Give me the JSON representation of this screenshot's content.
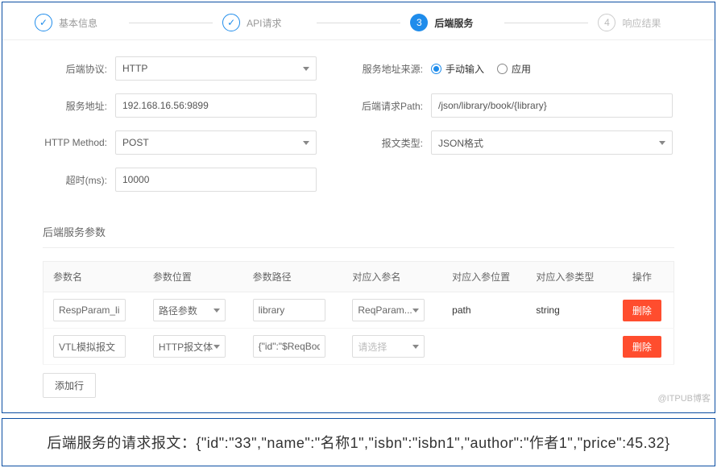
{
  "stepper": {
    "steps": [
      {
        "label": "基本信息",
        "state": "done",
        "icon": "✓"
      },
      {
        "label": "API请求",
        "state": "done",
        "icon": "✓"
      },
      {
        "label": "后端服务",
        "state": "active",
        "icon": "3"
      },
      {
        "label": "响应结果",
        "state": "pending",
        "icon": "4"
      }
    ]
  },
  "form": {
    "protocol_label": "后端协议:",
    "protocol_value": "HTTP",
    "source_label": "服务地址来源:",
    "source_options": {
      "manual": "手动输入",
      "app": "应用"
    },
    "address_label": "服务地址:",
    "address_value": "192.168.16.56:9899",
    "path_label": "后端请求Path:",
    "path_value": "/json/library/book/{library}",
    "method_label": "HTTP Method:",
    "method_value": "POST",
    "msgtype_label": "报文类型:",
    "msgtype_value": "JSON格式",
    "timeout_label": "超时(ms):",
    "timeout_value": "10000"
  },
  "section_title": "后端服务参数",
  "table": {
    "headers": [
      "参数名",
      "参数位置",
      "参数路径",
      "对应入参名",
      "对应入参位置",
      "对应入参类型",
      "操作"
    ],
    "rows": [
      {
        "name": "RespParam_libra",
        "pos": "路径参数",
        "path": "library",
        "in_name": "ReqParam...",
        "in_pos": "path",
        "in_type": "string"
      },
      {
        "name": "VTL模拟报文",
        "pos": "HTTP报文体",
        "path": "{\"id\":\"$ReqBody_",
        "in_name": "请选择",
        "in_name_placeholder": true,
        "in_pos": "",
        "in_type": ""
      }
    ],
    "delete_label": "删除",
    "add_label": "添加行"
  },
  "bottom_text": "后端服务的请求报文：{\"id\":\"33\",\"name\":\"名称1\",\"isbn\":\"isbn1\",\"author\":\"作者1\",\"price\":45.32}",
  "watermark": "@ITPUB博客"
}
